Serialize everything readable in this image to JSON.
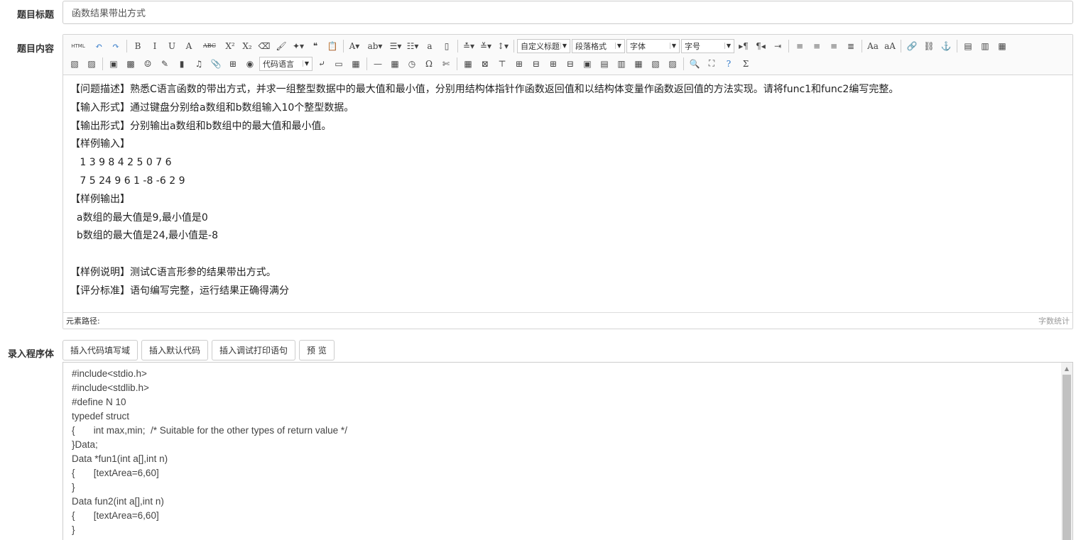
{
  "form": {
    "title_label": "题目标题",
    "title_value": "函数结果带出方式",
    "content_label": "题目内容",
    "program_label": "录入程序体"
  },
  "toolbar": {
    "row1": [
      {
        "name": "html-source-button",
        "glyph": "HTML"
      },
      {
        "name": "undo-button",
        "glyph": "↶"
      },
      {
        "name": "redo-button",
        "glyph": "↷"
      },
      {
        "sep": true
      },
      {
        "name": "bold-button",
        "glyph": "B"
      },
      {
        "name": "italic-button",
        "glyph": "I"
      },
      {
        "name": "underline-button",
        "glyph": "U"
      },
      {
        "name": "font-border-button",
        "glyph": "A"
      },
      {
        "name": "strikethrough-button",
        "glyph": "ABC"
      },
      {
        "name": "superscript-button",
        "glyph": "X²"
      },
      {
        "name": "subscript-button",
        "glyph": "X₂"
      },
      {
        "name": "eraser-button",
        "glyph": "⌫"
      },
      {
        "name": "format-painter-button",
        "glyph": "🖌"
      },
      {
        "name": "auto-format-button",
        "glyph": "✦▾"
      },
      {
        "name": "blockquote-button",
        "glyph": "❝"
      },
      {
        "name": "paste-plain-button",
        "glyph": "📋"
      },
      {
        "sep": true
      },
      {
        "name": "font-color-button",
        "glyph": "A▾"
      },
      {
        "name": "back-color-button",
        "glyph": "ab▾"
      },
      {
        "name": "ordered-list-button",
        "glyph": "☰▾"
      },
      {
        "name": "unordered-list-button",
        "glyph": "☷▾"
      },
      {
        "name": "select-all-button",
        "glyph": "a"
      },
      {
        "name": "clear-doc-button",
        "glyph": "▯"
      },
      {
        "sep": true
      },
      {
        "name": "row-spacing-top-button",
        "glyph": "≛▾"
      },
      {
        "name": "row-spacing-bottom-button",
        "glyph": "≚▾"
      },
      {
        "name": "line-height-button",
        "glyph": "↕▾"
      },
      {
        "sep": true
      }
    ],
    "selects": {
      "custom_style": "自定义标题",
      "paragraph": "段落格式",
      "font_family": "字体",
      "font_size": "字号",
      "code_language": "代码语言"
    },
    "row1_tail": [
      {
        "name": "direction-ltr-button",
        "glyph": "▸¶"
      },
      {
        "name": "direction-rtl-button",
        "glyph": "¶◂"
      },
      {
        "name": "indent-button",
        "glyph": "⇥"
      },
      {
        "sep": true
      },
      {
        "name": "justify-left-button",
        "glyph": "≡"
      },
      {
        "name": "justify-center-button",
        "glyph": "≡"
      },
      {
        "name": "justify-right-button",
        "glyph": "≡"
      },
      {
        "name": "justify-full-button",
        "glyph": "≣"
      },
      {
        "sep": true
      },
      {
        "name": "touppercase-button",
        "glyph": "Aa"
      },
      {
        "name": "tolowercase-button",
        "glyph": "aA"
      },
      {
        "sep": true
      },
      {
        "name": "link-button",
        "glyph": "🔗"
      },
      {
        "name": "unlink-button",
        "glyph": "⛓"
      },
      {
        "name": "anchor-button",
        "glyph": "⚓"
      },
      {
        "sep": true
      },
      {
        "name": "image-none-button",
        "glyph": "▤"
      },
      {
        "name": "image-left-button",
        "glyph": "▥"
      },
      {
        "name": "image-center-button",
        "glyph": "▦"
      }
    ],
    "row2_a": [
      {
        "name": "image-right-button",
        "glyph": "▧"
      },
      {
        "name": "image-block-button",
        "glyph": "▨"
      },
      {
        "sep": true
      },
      {
        "name": "insert-image-button",
        "glyph": "▣"
      },
      {
        "name": "insert-multi-image-button",
        "glyph": "▩"
      },
      {
        "name": "emotion-button",
        "glyph": "☺"
      },
      {
        "name": "scrawl-button",
        "glyph": "✎"
      },
      {
        "name": "insert-video-button",
        "glyph": "▮"
      },
      {
        "name": "music-button",
        "glyph": "♫"
      },
      {
        "name": "attachment-button",
        "glyph": "📎"
      },
      {
        "name": "map-button",
        "glyph": "⊞"
      },
      {
        "name": "insert-frame-button",
        "glyph": "◉"
      }
    ],
    "row2_b": [
      {
        "name": "page-break-button",
        "glyph": "⤶"
      },
      {
        "name": "template-button",
        "glyph": "▭"
      },
      {
        "name": "background-button",
        "glyph": "▦"
      },
      {
        "sep": true
      },
      {
        "name": "horizontal-rule-button",
        "glyph": "—"
      },
      {
        "name": "date-button",
        "glyph": "▦"
      },
      {
        "name": "time-button",
        "glyph": "◷"
      },
      {
        "name": "special-chars-button",
        "glyph": "Ω"
      },
      {
        "name": "snapscreen-button",
        "glyph": "✄"
      },
      {
        "sep": true
      },
      {
        "name": "insert-table-button",
        "glyph": "▦"
      },
      {
        "name": "delete-table-button",
        "glyph": "⊠"
      },
      {
        "name": "insert-paragraph-before-table-button",
        "glyph": "⊤"
      },
      {
        "name": "insert-row-button",
        "glyph": "⊞"
      },
      {
        "name": "delete-row-button",
        "glyph": "⊟"
      },
      {
        "name": "insert-col-button",
        "glyph": "⊞"
      },
      {
        "name": "delete-col-button",
        "glyph": "⊟"
      },
      {
        "name": "merge-cells-button",
        "glyph": "▣"
      },
      {
        "name": "merge-right-button",
        "glyph": "▤"
      },
      {
        "name": "merge-down-button",
        "glyph": "▥"
      },
      {
        "name": "split-to-cells-button",
        "glyph": "▦"
      },
      {
        "name": "split-to-rows-button",
        "glyph": "▧"
      },
      {
        "name": "split-to-cols-button",
        "glyph": "▨"
      },
      {
        "sep": true
      },
      {
        "name": "search-replace-button",
        "glyph": "🔍"
      },
      {
        "name": "print-preview-button",
        "glyph": "⛶"
      },
      {
        "name": "help-button",
        "glyph": "?"
      },
      {
        "name": "formula-button",
        "glyph": "Σ"
      }
    ]
  },
  "content": {
    "lines": [
      "【问题描述】熟悉C语言函数的带出方式，并求一组整型数据中的最大值和最小值，分别用结构体指针作函数返回值和以结构体变量作函数返回值的方法实现。请将func1和func2编写完整。",
      "【输入形式】通过键盘分别给a数组和b数组输入10个整型数据。",
      "【输出形式】分别输出a数组和b数组中的最大值和最小值。",
      "【样例输入】",
      "   1 3 9 8 4 2 5 0 7 6",
      "   7 5 24 9 6 1 -8 -6 2 9",
      "【样例输出】",
      "  a数组的最大值是9,最小值是0",
      "  b数组的最大值是24,最小值是-8",
      "",
      "【样例说明】测试C语言形参的结果带出方式。",
      "【评分标准】语句编写完整，运行结果正确得满分"
    ]
  },
  "statusbar": {
    "path_label": "元素路径:",
    "word_count_label": "字数统计"
  },
  "buttons": {
    "insert_code_area": "插入代码填写域",
    "insert_default_code": "插入默认代码",
    "insert_debug_print": "插入调试打印语句",
    "preview": "预 览"
  },
  "code": {
    "text": "#include<stdio.h>\n#include<stdlib.h>\n#define N 10\ntypedef struct\n{       int max,min;  /* Suitable for the other types of return value */\n}Data;\nData *fun1(int a[],int n)\n{       [textArea=6,60]\n}\nData fun2(int a[],int n)\n{       [textArea=6,60]\n}"
  }
}
